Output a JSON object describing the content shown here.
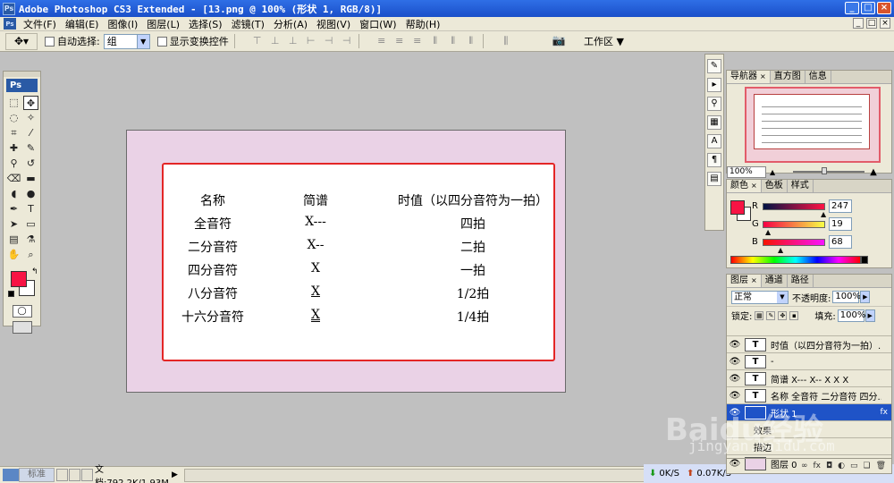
{
  "window": {
    "title": "Adobe Photoshop CS3 Extended - [13.png @ 100% (形状 1, RGB/8)]",
    "min": "_",
    "restore": "□",
    "close": "×"
  },
  "menu": [
    "文件(F)",
    "编辑(E)",
    "图像(I)",
    "图层(L)",
    "选择(S)",
    "滤镜(T)",
    "分析(A)",
    "视图(V)",
    "窗口(W)",
    "帮助(H)"
  ],
  "options": {
    "auto_select_label": "自动选择:",
    "auto_select_value": "组",
    "show_transform_label": "显示变换控件",
    "workspace_label": "工作区"
  },
  "document": {
    "headers": [
      "名称",
      "简谱",
      "时值（以四分音符为一拍）"
    ],
    "rows": [
      [
        "全音符",
        "X---",
        "四拍"
      ],
      [
        "二分音符",
        "X--",
        "二拍"
      ],
      [
        "四分音符",
        "X",
        "一拍"
      ],
      [
        "八分音符",
        "X",
        "1/2拍"
      ],
      [
        "十六分音符",
        "X",
        "1/4拍"
      ]
    ]
  },
  "status": {
    "std_label": "标准",
    "doc_size": "文档:792.2K/1.93M"
  },
  "tray": {
    "down_speed": "0K/S",
    "up_speed": "0.07K/S"
  },
  "navigator": {
    "tabs": [
      "导航器",
      "直方图",
      "信息"
    ],
    "zoom": "100%"
  },
  "color_panel": {
    "tabs": [
      "颜色",
      "色板",
      "样式"
    ],
    "r_label": "R",
    "r": "247",
    "g_label": "G",
    "g": "19",
    "b_label": "B",
    "b": "68"
  },
  "layers_panel": {
    "tabs": [
      "图层",
      "通道",
      "路径"
    ],
    "blend_mode": "正常",
    "opacity_label": "不透明度:",
    "opacity": "100%",
    "lock_label": "锁定:",
    "fill_label": "填充:",
    "fill": "100%",
    "layers": [
      {
        "name": "时值（以四分音符为一拍）...",
        "type": "T"
      },
      {
        "name": "-",
        "type": "T"
      },
      {
        "name": "简谱 X--- X-- X X X",
        "type": "T"
      },
      {
        "name": "名称 全音符 二分音符 四分...",
        "type": "T"
      },
      {
        "name": "形状 1",
        "type": "shape"
      },
      {
        "name": "效果",
        "type": "sub"
      },
      {
        "name": "描边",
        "type": "sub"
      },
      {
        "name": "图层 0",
        "type": "image"
      }
    ],
    "fx": "fx"
  },
  "watermark": {
    "brand": "Baidu经验",
    "url": "jingyan.baidu.com"
  },
  "colors": {
    "foreground": "#f71344",
    "shape_border": "#e42626",
    "canvas_bg": "#ead2e6",
    "title_bar": "#1a4fc9"
  }
}
